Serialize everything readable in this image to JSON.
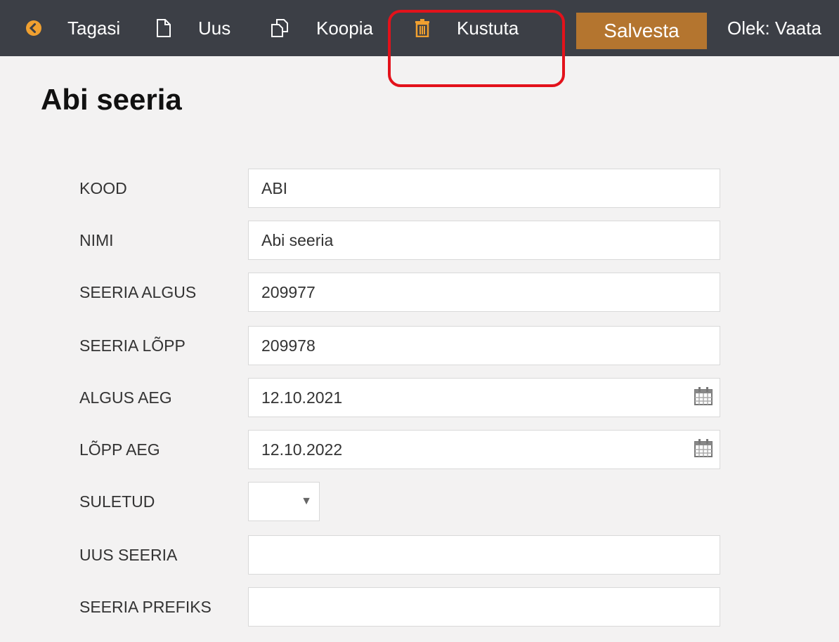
{
  "toolbar": {
    "back_label": "Tagasi",
    "new_label": "Uus",
    "copy_label": "Koopia",
    "delete_label": "Kustuta",
    "save_label": "Salvesta",
    "status_text": "Olek: Vaata",
    "icons": [
      "back-arrow-icon",
      "document-icon",
      "copy-icon",
      "trash-icon"
    ],
    "save_color": "#b4752f",
    "bar_color": "#3c3f46",
    "highlight_color": "#e3121b"
  },
  "page": {
    "title": "Abi seeria"
  },
  "form": {
    "kood": {
      "label": "KOOD",
      "value": "ABI"
    },
    "nimi": {
      "label": "NIMI",
      "value": "Abi seeria"
    },
    "seeria_algus": {
      "label": "SEERIA ALGUS",
      "value": "209977"
    },
    "seeria_lopp": {
      "label": "SEERIA LÕPP",
      "value": "209978"
    },
    "algus_aeg": {
      "label": "ALGUS AEG",
      "value": "12.10.2021"
    },
    "lopp_aeg": {
      "label": "LÕPP AEG",
      "value": "12.10.2022"
    },
    "suletud": {
      "label": "SULETUD",
      "value": "",
      "caret": "▼"
    },
    "uus_seeria": {
      "label": "UUS SEERIA",
      "value": ""
    },
    "seeria_prefiks": {
      "label": "SEERIA PREFIKS",
      "value": ""
    }
  }
}
